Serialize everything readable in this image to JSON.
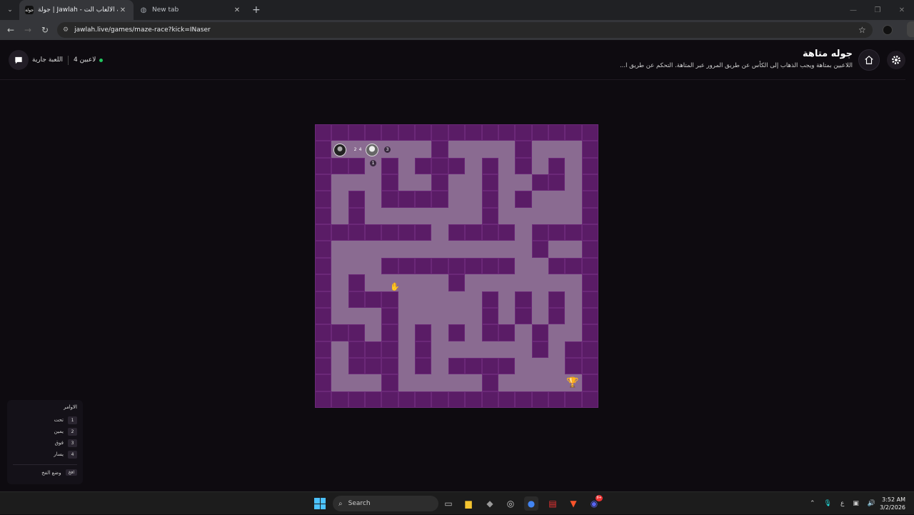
{
  "browser": {
    "tabs": [
      {
        "favicon": "جولة",
        "title": "جولة | Jawlah - منصة الألعاب الت..."
      },
      {
        "favicon": "globe-icon",
        "title": "New tab"
      }
    ],
    "url": "jawlah.live/games/maze-race?kick=INaser"
  },
  "header": {
    "title": "جوله متاهة",
    "description": "اللاعبين بمتاهة ويجب الذهاب إلى الكأس عن طريق المرور عبر المتاهة. التحكم عن طريق ا...",
    "status": "اللعبة جارية",
    "players": "4 لاعبين",
    "status_color": "#22c55e"
  },
  "maze": {
    "size": 17,
    "rows": [
      "WWWWWWWWWWWWWWWWW",
      "WPPPPPPWPPPPWPPPW",
      "WWWPWPWWWPWPWPWPW",
      "WPPPWPPWPPWPPWWPW",
      "WPWPWWWWPPWPWPPPW",
      "WPWPPPPPPPWPPPPPW",
      "WWWWWWWPWWWWPWWWW",
      "WPPPPPPPPPPPPWPPW",
      "WPPPWWWWWWWWPPWWW",
      "WPWPPPPPWPPPPPPPW",
      "WPWWWPPPPPWPWPWPW",
      "WPPPWPPPPPWPWPWPW",
      "WWWPWPWPWPWWPWPPW",
      "WPWWWPWPPPPPPWPWW",
      "WPWWWPWPWWWWPPPWW",
      "WPPPWPPPPPWPPPPPW",
      "WWWWWWWWWWWWWWWWW"
    ],
    "players": [
      {
        "label": "2",
        "labels_extra": "4"
      },
      {
        "label": "3",
        "below": "1"
      }
    ],
    "goal": "trophy-icon"
  },
  "commands": {
    "title": "الاوامر",
    "items": [
      {
        "key": "1",
        "label": "تحت"
      },
      {
        "key": "2",
        "label": "يمين"
      },
      {
        "key": "3",
        "label": "فوق"
      },
      {
        "key": "4",
        "label": "يسار"
      }
    ],
    "trap_key": "افخ",
    "trap_label": "وضع الفخ"
  },
  "taskbar": {
    "search_placeholder": "Search",
    "time": "3:52 AM",
    "date": "3/2/2026",
    "lang": "ع",
    "discord_badge": "9+"
  }
}
